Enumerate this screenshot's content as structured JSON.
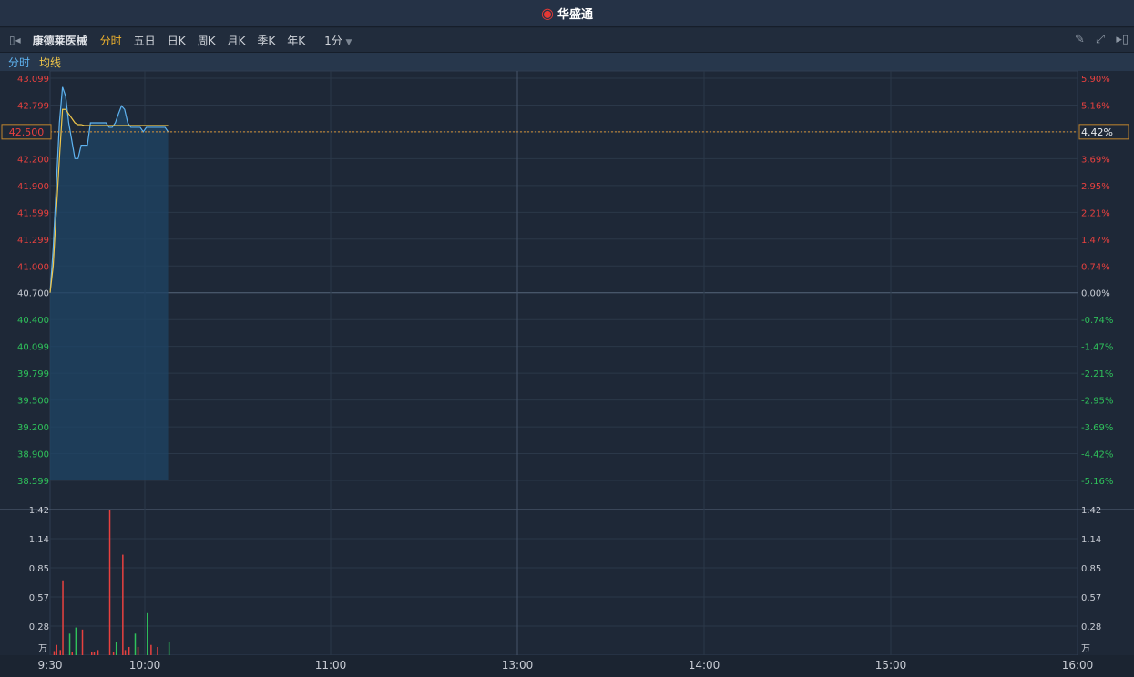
{
  "title": {
    "brand": "华盛通",
    "logo_icon": "weibo-eye-icon"
  },
  "toolbar": {
    "stock_name": "康德莱医械",
    "tabs": [
      "分时",
      "五日",
      "日K",
      "周K",
      "月K",
      "季K",
      "年K"
    ],
    "active_tab": "分时",
    "interval": "1分"
  },
  "legend": {
    "price": "分时",
    "avg": "均线"
  },
  "colors": {
    "up": "#e8413f",
    "down": "#2fc25b",
    "price_line": "#5fb3f0",
    "avg_line": "#f0c64a",
    "accent": "#f0b32d"
  },
  "crosshair": {
    "price": "42.500",
    "pct": "4.42%"
  },
  "chart_data": {
    "type": "line",
    "prev_close": 40.7,
    "price_ticks": [
      "43.099",
      "42.799",
      "42.500",
      "42.200",
      "41.900",
      "41.599",
      "41.299",
      "41.000",
      "40.700",
      "40.400",
      "40.099",
      "39.799",
      "39.500",
      "39.200",
      "38.900",
      "38.599"
    ],
    "pct_ticks": [
      "5.90%",
      "5.16%",
      "4.42%",
      "3.69%",
      "2.95%",
      "2.21%",
      "1.47%",
      "0.74%",
      "0.00%",
      "-0.74%",
      "-1.47%",
      "-2.21%",
      "-2.95%",
      "-3.69%",
      "-4.42%",
      "-5.16%"
    ],
    "ylim": [
      38.599,
      43.099
    ],
    "volume_ticks": [
      "1.42",
      "1.14",
      "0.85",
      "0.57",
      "0.28"
    ],
    "volume_unit": "万",
    "volume_max": 1.42,
    "time_ticks": [
      "9:30",
      "10:00",
      "11:00",
      "13:00",
      "14:00",
      "15:00",
      "16:00"
    ],
    "price": [
      40.7,
      41.2,
      41.9,
      42.6,
      43.0,
      42.9,
      42.6,
      42.4,
      42.2,
      42.2,
      42.35,
      42.35,
      42.35,
      42.6,
      42.6,
      42.6,
      42.6,
      42.6,
      42.6,
      42.55,
      42.55,
      42.6,
      42.7,
      42.79,
      42.75,
      42.6,
      42.55,
      42.55,
      42.55,
      42.55,
      42.5,
      42.55,
      42.55,
      42.55,
      42.55,
      42.55,
      42.55,
      42.55,
      42.5
    ],
    "avg": [
      40.7,
      41.0,
      41.6,
      42.2,
      42.75,
      42.75,
      42.7,
      42.65,
      42.6,
      42.58,
      42.58,
      42.57,
      42.57,
      42.57,
      42.57,
      42.57,
      42.57,
      42.57,
      42.57,
      42.57,
      42.57,
      42.57,
      42.57,
      42.57,
      42.57,
      42.57,
      42.57,
      42.57,
      42.57,
      42.57,
      42.57,
      42.57,
      42.57,
      42.57,
      42.57,
      42.57,
      42.57,
      42.57,
      42.57
    ],
    "volume": [
      [
        1.3,
        0.04,
        "up"
      ],
      [
        2.1,
        0.1,
        "up"
      ],
      [
        3.3,
        0.05,
        "up"
      ],
      [
        4.1,
        0.73,
        "up"
      ],
      [
        6.3,
        0.21,
        "down"
      ],
      [
        7.1,
        0.03,
        "up"
      ],
      [
        8.3,
        0.27,
        "down"
      ],
      [
        10.4,
        0.25,
        "up"
      ],
      [
        13.4,
        0.03,
        "up"
      ],
      [
        14.2,
        0.03,
        "up"
      ],
      [
        15.4,
        0.05,
        "up"
      ],
      [
        19.2,
        1.42,
        "up"
      ],
      [
        20.4,
        0.03,
        "up"
      ],
      [
        21.3,
        0.13,
        "down"
      ],
      [
        23.4,
        0.98,
        "up"
      ],
      [
        24.2,
        0.05,
        "up"
      ],
      [
        25.4,
        0.08,
        "up"
      ],
      [
        27.4,
        0.21,
        "down"
      ],
      [
        28.3,
        0.08,
        "up"
      ],
      [
        31.3,
        0.41,
        "down"
      ],
      [
        32.5,
        0.1,
        "up"
      ],
      [
        34.6,
        0.08,
        "up"
      ],
      [
        38.3,
        0.13,
        "down"
      ]
    ]
  }
}
